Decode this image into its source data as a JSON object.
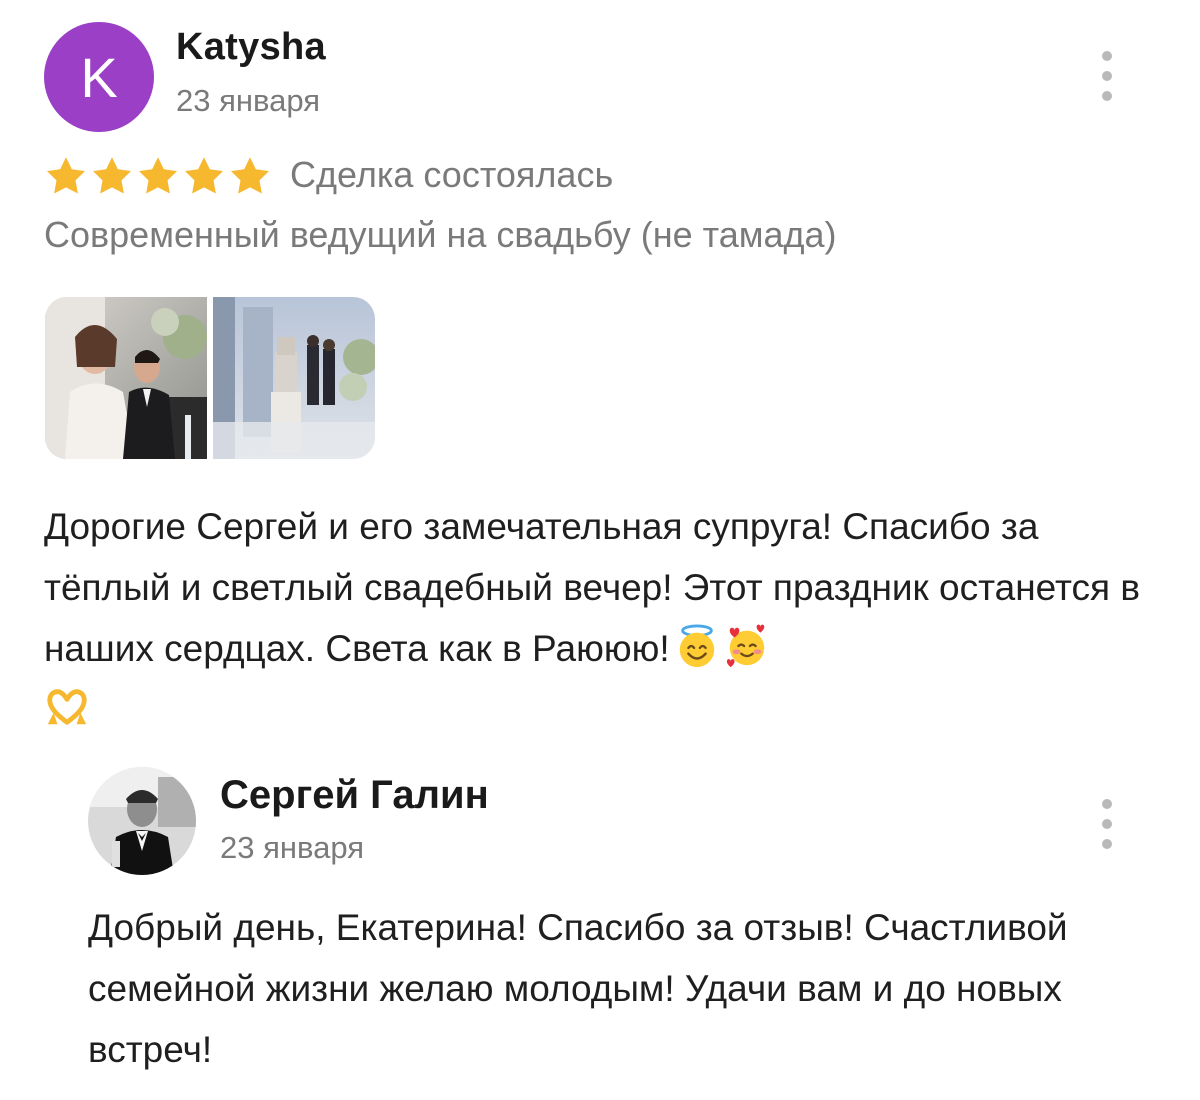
{
  "review": {
    "author": {
      "initial": "K",
      "name": "Katysha",
      "avatar_color": "#9a3fc6"
    },
    "date": "23 января",
    "rating": 5,
    "rating_color": "#f5b82e",
    "deal_status": "Сделка состоялась",
    "service": "Современный ведущий на свадьбу (не тамада)",
    "photos": [
      {
        "alt": "wedding-couple-photo"
      },
      {
        "alt": "wedding-cake-hall-photo"
      }
    ],
    "text": "Дорогие Сергей и его замечательная супруга! Спасибо за тёплый и светлый свадебный вечер! Этот праздник останется в наших сердцах. Света как в Раююю!",
    "emojis": [
      "smiling-face-with-halo",
      "smiling-face-with-hearts",
      "heart-hands"
    ]
  },
  "reply": {
    "author": {
      "name": "Сергей Галин"
    },
    "date": "23 января",
    "text": "Добрый день, Екатерина! Спасибо за отзыв! Счастливой семейной жизни желаю молодым! Удачи вам и до новых встреч!"
  }
}
